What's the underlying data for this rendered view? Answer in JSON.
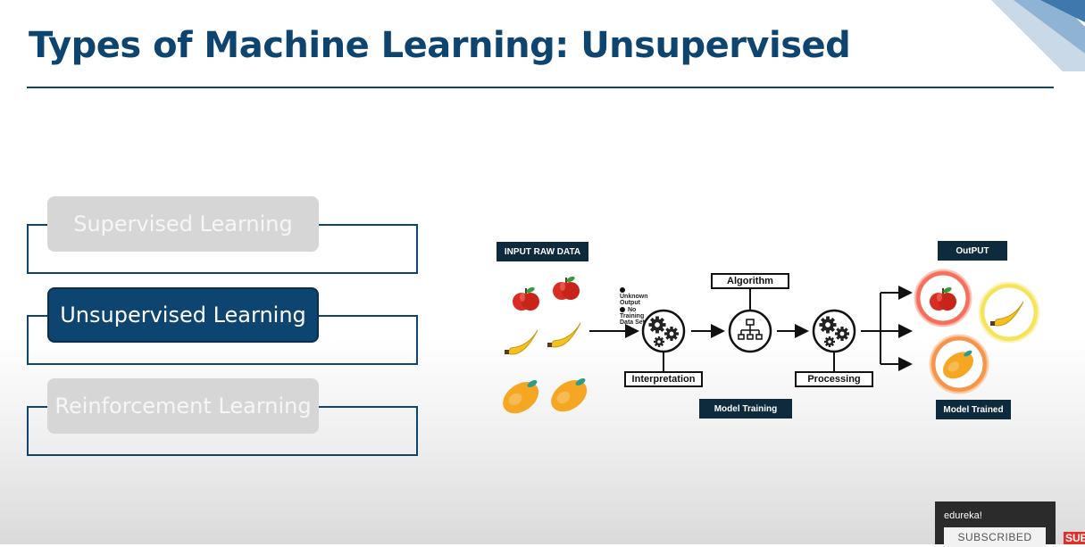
{
  "slide": {
    "title": "Types of Machine Learning: Unsupervised",
    "accent_color": "#0e4470"
  },
  "menu": {
    "items": [
      {
        "label": "Supervised Learning",
        "state": "inactive"
      },
      {
        "label": "Unsupervised Learning",
        "state": "active"
      },
      {
        "label": "Reinforcement Learning",
        "state": "inactive"
      }
    ]
  },
  "diagram": {
    "input_label": "INPUT RAW DATA",
    "legend": [
      "Unknown Output",
      "No Training Data Set"
    ],
    "interpretation_label": "Interpretation",
    "algorithm_label": "Algorithm",
    "model_training_label": "Model Training",
    "processing_label": "Processing",
    "output_label": "OutPUT",
    "model_trained_label": "Model Trained",
    "icons": [
      "apple-icon",
      "banana-icon",
      "mango-icon",
      "gears-icon",
      "hierarchy-icon"
    ]
  },
  "youtube": {
    "channel": "edureka!",
    "subscribed_label": "SUBSCRIBED",
    "subscribe_badge": "SUBSCRIBE"
  }
}
